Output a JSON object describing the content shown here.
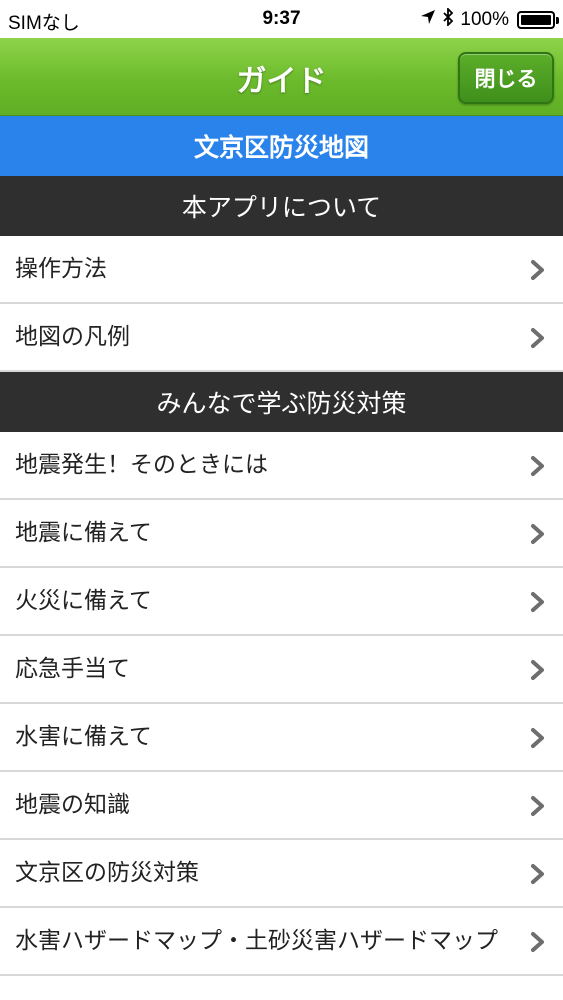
{
  "status_bar": {
    "carrier": "SIMなし",
    "time": "9:37",
    "battery": "100%",
    "icons": [
      "location-arrow-icon",
      "bluetooth-icon",
      "battery-icon"
    ]
  },
  "nav": {
    "title": "ガイド",
    "close_label": "閉じる"
  },
  "map_title": "文京区防災地図",
  "sections": [
    {
      "title": "本アプリについて",
      "items": [
        "操作方法",
        "地図の凡例"
      ]
    },
    {
      "title": "みんなで学ぶ防災対策",
      "items": [
        "地震発生！そのときには",
        "地震に備えて",
        "火災に備えて",
        "応急手当て",
        "水害に備えて",
        "地震の知識",
        "文京区の防災対策",
        "水害ハザードマップ・土砂災害ハザードマップ"
      ]
    }
  ],
  "colors": {
    "nav_green": "#6cbb2c",
    "map_title_blue": "#2a83ea",
    "section_header_dark": "#2f2f2f"
  }
}
